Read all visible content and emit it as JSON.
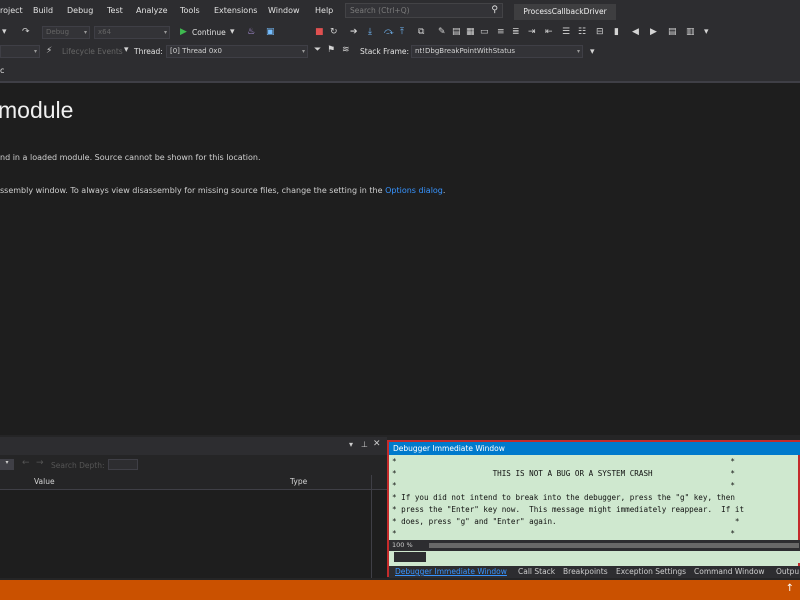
{
  "menu": {
    "items": [
      "roject",
      "Build",
      "Debug",
      "Test",
      "Analyze",
      "Tools",
      "Extensions",
      "Window",
      "Help"
    ],
    "search_placeholder": "Search (Ctrl+Q)",
    "project_title": "ProcessCallbackDriver"
  },
  "toolbar1": {
    "config": "Debug",
    "platform": "x64",
    "continue_label": "Continue"
  },
  "toolbar2": {
    "lifecycle_label": "Lifecycle Events",
    "thread_label": "Thread:",
    "thread_value": "[0] Thread 0x0",
    "stack_frame_label": "Stack Frame:",
    "stack_frame_value": "nt!DbgBreakPointWithStatus"
  },
  "document_tab": "c",
  "main": {
    "heading": "module",
    "line1": "nd in a loaded module. Source cannot be shown for this location.",
    "line2_prefix": "ssembly window. To always view disassembly for missing source files, change the setting in the ",
    "line2_link": "Options dialog",
    "line2_suffix": "."
  },
  "locals": {
    "search_placeholder": "Search Depth:",
    "columns": [
      "Value",
      "Type"
    ]
  },
  "immediate": {
    "title": "Debugger Immediate Window",
    "text": "*                                                                         *\n*                     THIS IS NOT A BUG OR A SYSTEM CRASH                 *\n*                                                                         *\n* If you did not intend to break into the debugger, press the \"g\" key, then\n* press the \"Enter\" key now.  This message might immediately reappear.  If it\n* does, press \"g\" and \"Enter\" again.                                       *\n*                                                                         *",
    "zoom": "100 %"
  },
  "bottom_tabs": [
    "Debugger Immediate Window",
    "Call Stack",
    "Breakpoints",
    "Exception Settings",
    "Command Window",
    "Outpu"
  ],
  "colors": {
    "accent": "#007acc",
    "status": "#ca5100",
    "highlight": "#c42b2b"
  }
}
